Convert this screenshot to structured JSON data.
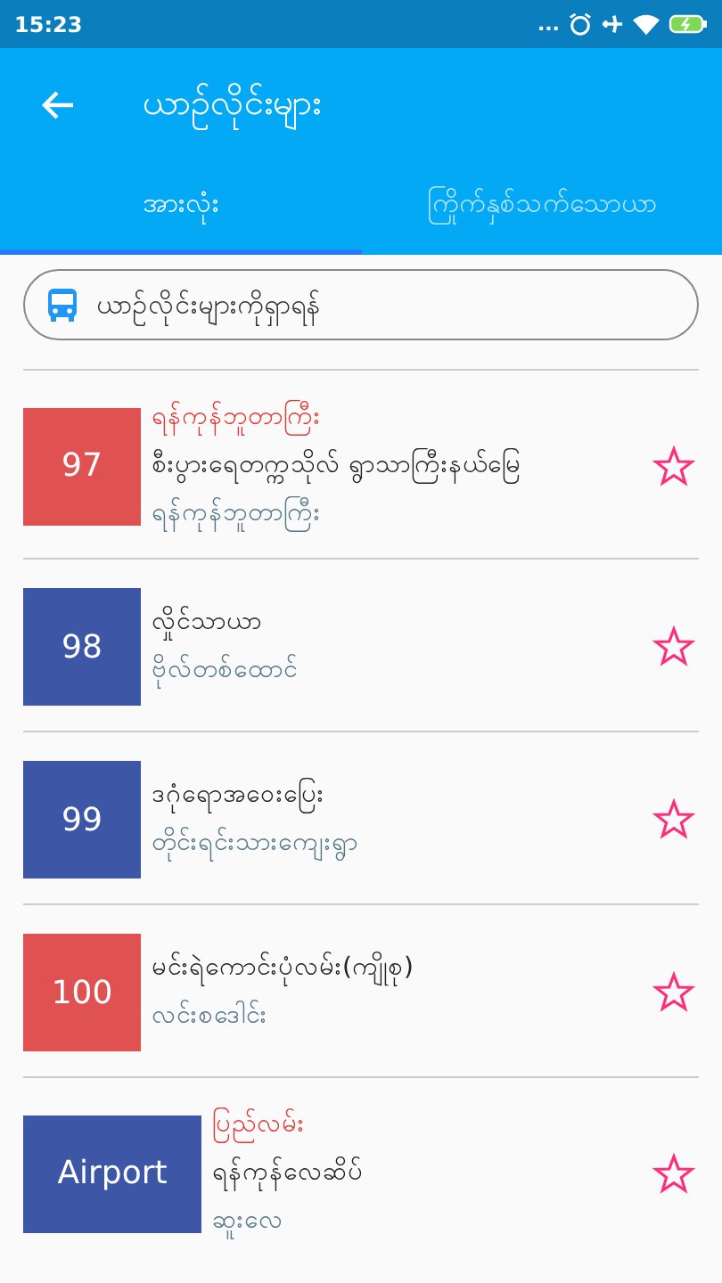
{
  "status_bar": {
    "time": "15:23",
    "dots": "..."
  },
  "app_bar": {
    "title": "ယာဥ်လိုင်းများ"
  },
  "tabs": [
    {
      "label": "အားလုံး",
      "selected": true
    },
    {
      "label": "ကြိုက်နှစ်သက်သောယာ",
      "selected": false
    }
  ],
  "search": {
    "placeholder": "ယာဥ်လိုင်းများကိုရှာရန်"
  },
  "routes": [
    {
      "number": "97",
      "color": "#e05252",
      "note": "ရန်ကုန်ဘူတာကြီး",
      "title": "စီးပွားရေတက္ကသိုလ် ရွာသာကြီးနယ်မြေ",
      "subtitle": "ရန်ကုန်ဘူတာကြီး",
      "starred": false
    },
    {
      "number": "98",
      "color": "#3d56a6",
      "title": "လှိုင်သာယာ",
      "subtitle": "ဗိုလ်တစ်ထောင်",
      "starred": false
    },
    {
      "number": "99",
      "color": "#3d56a6",
      "title": "ဒဂုံရောအဝေးပြေး",
      "subtitle": "တိုင်းရင်းသားကျေးရွာ",
      "starred": false
    },
    {
      "number": "100",
      "color": "#e05252",
      "title": "မင်းရဲကောင်းပုံလမ်း(ကျိုစု)",
      "subtitle": "လင်းစဒေါင်း",
      "starred": false
    },
    {
      "number": "Airport",
      "color": "#3d56a6",
      "note": "ပြည်လမ်း",
      "title": "ရန်ကုန်လေဆိပ်",
      "subtitle": "ဆူးလေ",
      "starred": false
    }
  ]
}
